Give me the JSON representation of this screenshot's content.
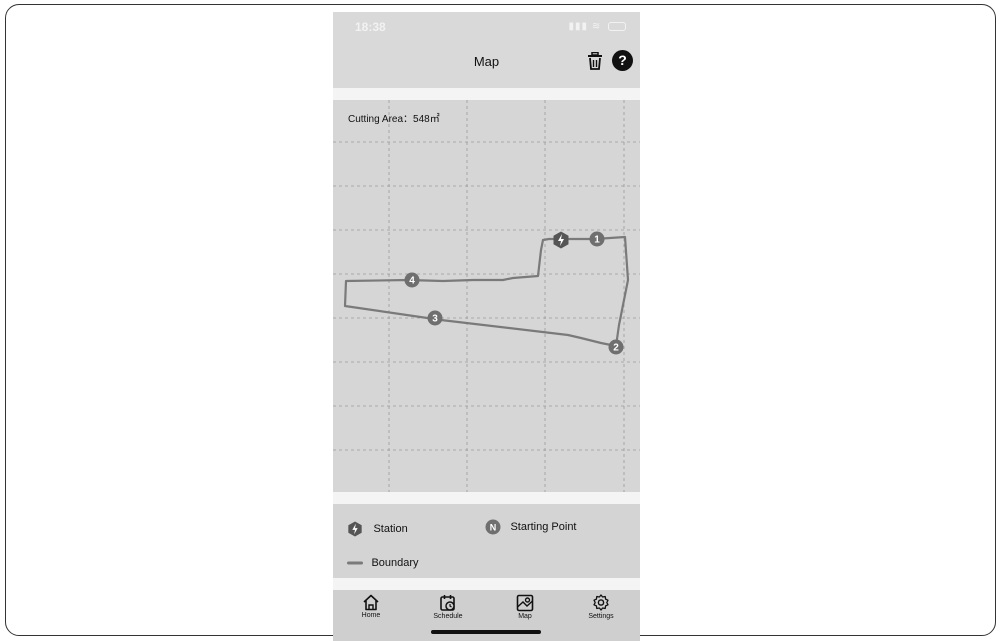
{
  "status_bar": {
    "time": "18:38"
  },
  "header": {
    "title": "Map",
    "help_label": "?",
    "trash_icon": "trash-icon",
    "help_icon": "question-icon"
  },
  "map": {
    "cutting_area_label": "Cutting Area：548㎡",
    "points": [
      {
        "label": "1",
        "kind": "boundary-point"
      },
      {
        "label": "2",
        "kind": "boundary-point"
      },
      {
        "label": "3",
        "kind": "boundary-point"
      },
      {
        "label": "4",
        "kind": "boundary-point"
      }
    ],
    "station_icon": "lightning-icon"
  },
  "legend": {
    "station": "Station",
    "starting_point": "Starting Point",
    "starting_point_symbol": "N",
    "boundary": "Boundary"
  },
  "tabs": [
    {
      "label": "Home",
      "icon": "home-icon"
    },
    {
      "label": "Schedule",
      "icon": "calendar-clock-icon"
    },
    {
      "label": "Map",
      "icon": "map-icon"
    },
    {
      "label": "Settings",
      "icon": "gear-icon"
    }
  ],
  "colors": {
    "boundary": "#7a7a7a",
    "marker": "#6f6f6f",
    "map_bg": "#d6d6d6"
  }
}
